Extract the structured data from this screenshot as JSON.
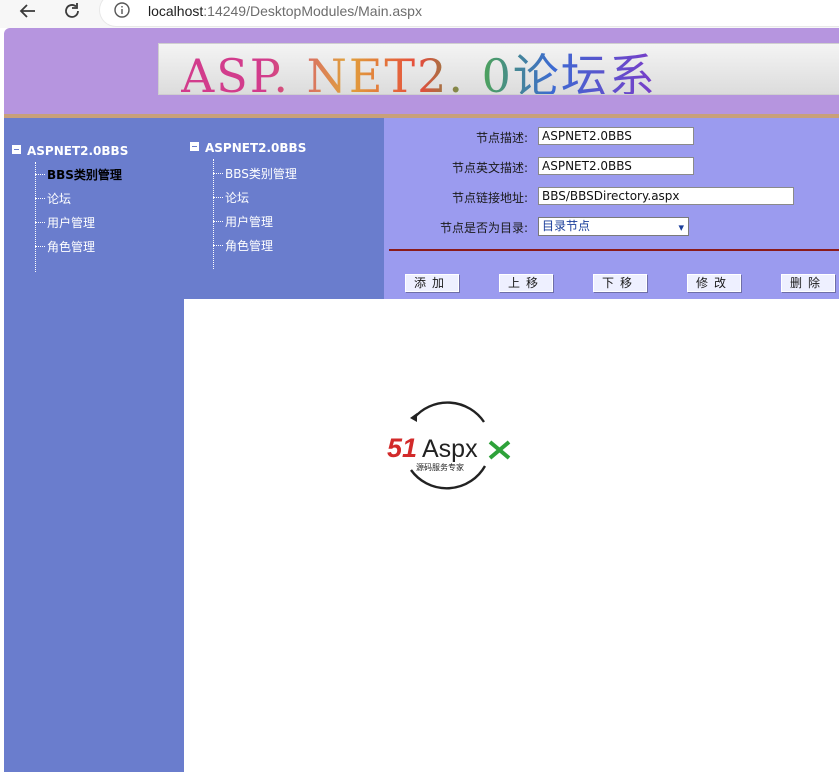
{
  "browser": {
    "url_host": "localhost",
    "url_rest": ":14249/DesktopModules/Main.aspx"
  },
  "banner": {
    "title": "ASP. NET2. 0论坛系"
  },
  "left_tree": {
    "root": "ASPNET2.0BBS",
    "items": [
      "BBS类别管理",
      "论坛",
      "用户管理",
      "角色管理"
    ],
    "selected": 0
  },
  "mid_tree": {
    "root": "ASPNET2.0BBS",
    "items": [
      "BBS类别管理",
      "论坛",
      "用户管理",
      "角色管理"
    ]
  },
  "form": {
    "desc_label": "节点描述:",
    "desc_value": "ASPNET2.0BBS",
    "en_desc_label": "节点英文描述:",
    "en_desc_value": "ASPNET2.0BBS",
    "link_label": "节点链接地址:",
    "link_value": "BBS/BBSDirectory.aspx",
    "is_dir_label": "节点是否为目录:",
    "is_dir_value": "目录节点"
  },
  "buttons": {
    "add": "添加",
    "up": "上移",
    "down": "下移",
    "edit": "修改",
    "delete": "删除"
  },
  "logo": {
    "brand_num": "51",
    "brand_text": "Aspx",
    "tagline": "源码服务专家"
  },
  "colors": {
    "banner": "#b695df",
    "tree_panel": "#6a7dcd",
    "form_panel": "#9b9bef",
    "divider": "#8b1a1a"
  }
}
